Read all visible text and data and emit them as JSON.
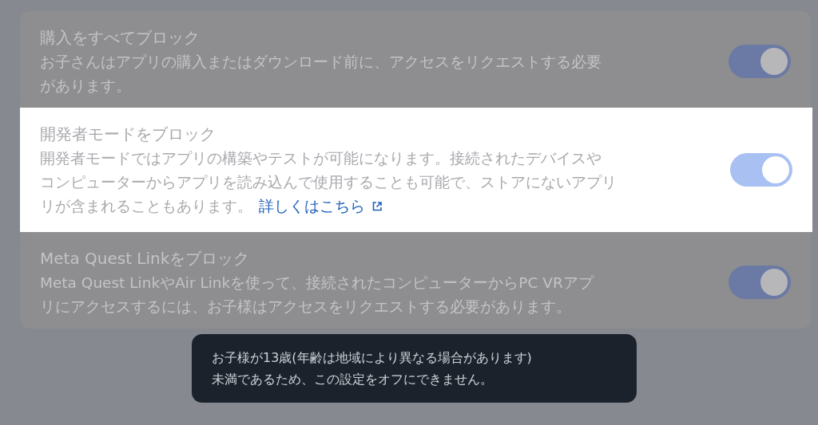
{
  "settings": [
    {
      "title": "購入をすべてブロック",
      "description_lines": [
        "お子さんはアプリの購入またはダウンロード前に、アクセスをリクエストする必要",
        "があります。"
      ],
      "on": true,
      "highlighted": false
    },
    {
      "title": "開発者モードをブロック",
      "description_lines": [
        "開発者モードではアプリの構築やテストが可能になります。接続されたデバイスや",
        "コンピューターからアプリを読み込んで使用することも可能で、ストアにないアプリ",
        "リが含まれることもあります。"
      ],
      "link": "詳しくはこちら",
      "on": true,
      "highlighted": true
    },
    {
      "title": "Meta Quest Linkをブロック",
      "description_lines": [
        "Meta Quest LinkやAir Linkを使って、接続されたコンピューターからPC VRアプ",
        "リにアクセスするには、お子様はアクセスをリクエストする必要があります。"
      ],
      "on": true,
      "highlighted": false
    }
  ],
  "tooltip": {
    "lines": [
      "お子様が13歳(年齢は地域により異なる場合があります)",
      "未満であるため、この設定をオフにできません。"
    ]
  }
}
